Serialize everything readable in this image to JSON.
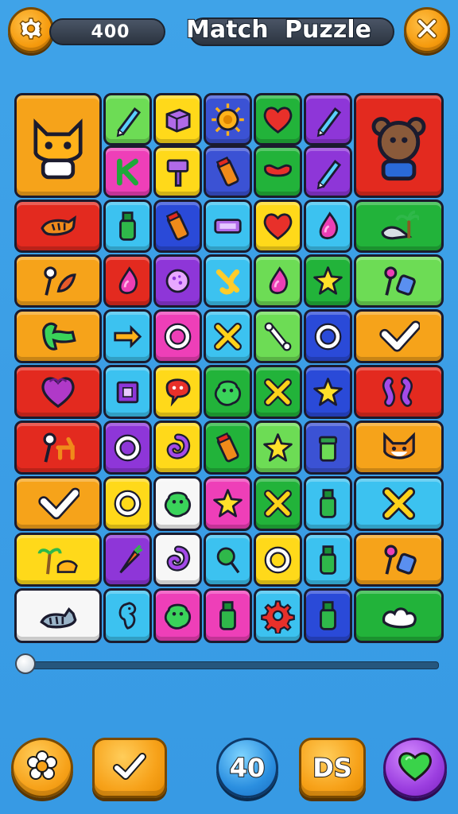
{
  "header": {
    "settings_icon": "gear-icon",
    "score": "400",
    "title": "Match  Puzzle",
    "close_icon": "close-icon"
  },
  "board": {
    "rows": 9,
    "cols": 7,
    "tiles": [
      {
        "color": "#f6a31a",
        "icon": "cat-character",
        "big": true
      },
      {
        "color": "#6ddc55",
        "icon": "pencil"
      },
      {
        "color": "#ffd91a",
        "icon": "box"
      },
      {
        "color": "#3b52d4",
        "icon": "sun"
      },
      {
        "color": "#22b33a",
        "icon": "heart"
      },
      {
        "color": "#8e36d8",
        "icon": "pencil"
      },
      {
        "color": "#e32a1f",
        "icon": "bear-character",
        "big": true
      },
      {
        "color": "#ee3fb8",
        "icon": "letter-k"
      },
      {
        "color": "#ffd91a",
        "icon": "hammer"
      },
      {
        "color": "#3b52d4",
        "icon": "tube"
      },
      {
        "color": "#22b33a",
        "icon": "bow"
      },
      {
        "color": "#8e36d8",
        "icon": "pencil"
      },
      {
        "color": "#e32a1f",
        "icon": "tiger"
      },
      {
        "color": "#3cc2f0",
        "icon": "bottle"
      },
      {
        "color": "#2a4ad8",
        "icon": "tube"
      },
      {
        "color": "#3cc2f0",
        "icon": "bar"
      },
      {
        "color": "#ffd91a",
        "icon": "heart"
      },
      {
        "color": "#3cc2f0",
        "icon": "drop"
      },
      {
        "color": "#22b33a",
        "icon": "seal-palm"
      },
      {
        "color": "#f6a31a",
        "icon": "lollipop-leaf"
      },
      {
        "color": "#e32a1f",
        "icon": "drop"
      },
      {
        "color": "#8e36d8",
        "icon": "circle-dots"
      },
      {
        "color": "#3cc2f0",
        "icon": "knot"
      },
      {
        "color": "#6ddc55",
        "icon": "drop"
      },
      {
        "color": "#22b33a",
        "icon": "star"
      },
      {
        "color": "#6ddc55",
        "icon": "lollipop-gem"
      },
      {
        "color": "#f6a31a",
        "icon": "fish"
      },
      {
        "color": "#3cc2f0",
        "icon": "arrow"
      },
      {
        "color": "#ee3fb8",
        "icon": "ring"
      },
      {
        "color": "#3cc2f0",
        "icon": "cross"
      },
      {
        "color": "#6ddc55",
        "icon": "bone"
      },
      {
        "color": "#2a4ad8",
        "icon": "ring"
      },
      {
        "color": "#f6a31a",
        "icon": "check"
      },
      {
        "color": "#e32a1f",
        "icon": "heart-palm"
      },
      {
        "color": "#3cc2f0",
        "icon": "square"
      },
      {
        "color": "#ffd91a",
        "icon": "bubble"
      },
      {
        "color": "#22b33a",
        "icon": "blob"
      },
      {
        "color": "#22b33a",
        "icon": "cross"
      },
      {
        "color": "#2a4ad8",
        "icon": "star"
      },
      {
        "color": "#e32a1f",
        "icon": "worms"
      },
      {
        "color": "#e32a1f",
        "icon": "lollipop-deer"
      },
      {
        "color": "#8e36d8",
        "icon": "ring"
      },
      {
        "color": "#ffd91a",
        "icon": "swirl"
      },
      {
        "color": "#22b33a",
        "icon": "tube"
      },
      {
        "color": "#6ddc55",
        "icon": "star"
      },
      {
        "color": "#3b52d4",
        "icon": "jar"
      },
      {
        "color": "#f6a31a",
        "icon": "fox"
      },
      {
        "color": "#f6a31a",
        "icon": "check"
      },
      {
        "color": "#ffd91a",
        "icon": "ring"
      },
      {
        "color": "#f7f7f7",
        "icon": "blob"
      },
      {
        "color": "#ee3fb8",
        "icon": "star"
      },
      {
        "color": "#22b33a",
        "icon": "cross"
      },
      {
        "color": "#3cc2f0",
        "icon": "bottle"
      },
      {
        "color": "#3cc2f0",
        "icon": "cross"
      },
      {
        "color": "#ffd91a",
        "icon": "palm-cat"
      },
      {
        "color": "#8e36d8",
        "icon": "carrot"
      },
      {
        "color": "#f7f7f7",
        "icon": "swirl"
      },
      {
        "color": "#3cc2f0",
        "icon": "lollipop"
      },
      {
        "color": "#ffd91a",
        "icon": "ring"
      },
      {
        "color": "#3cc2f0",
        "icon": "bottle"
      },
      {
        "color": "#f6a31a",
        "icon": "lollipop-gem"
      },
      {
        "color": "#f7f7f7",
        "icon": "cat"
      },
      {
        "color": "#3cc2f0",
        "icon": "seahorse"
      },
      {
        "color": "#ee3fb8",
        "icon": "blob"
      },
      {
        "color": "#ee3fb8",
        "icon": "bottle"
      },
      {
        "color": "#3cc2f0",
        "icon": "gear"
      },
      {
        "color": "#2a4ad8",
        "icon": "bottle"
      },
      {
        "color": "#22b33a",
        "icon": "cloud"
      }
    ]
  },
  "slider": {
    "value": 0
  },
  "bottom_bar": {
    "flower_icon": "flower-icon",
    "check_icon": "check-icon",
    "moves": "40",
    "code": "DS",
    "heart_icon": "heart-icon"
  }
}
